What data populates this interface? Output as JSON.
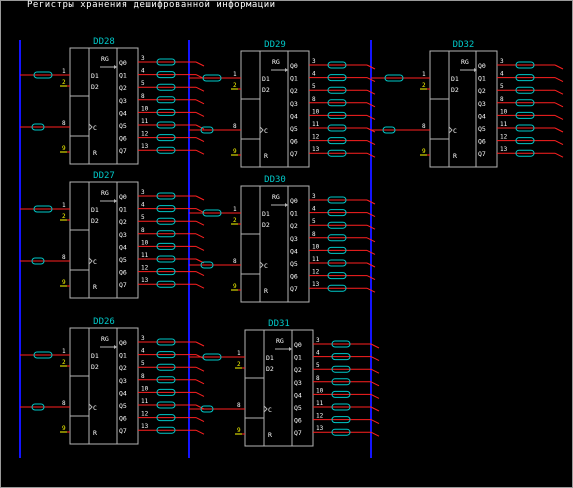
{
  "title": "Регистры хранения дешифрованной информации",
  "bus_color": "#1414ff",
  "wire_color": "#ff2020",
  "chip_color": "#b4b4b4",
  "label_color": "#00c8c8",
  "pin_color": "#ffff00",
  "text_color": "#ffffff",
  "chip_type": "RG",
  "input_labels": {
    "d1": "D1",
    "d2": "D2",
    "c": "C",
    "r": "R"
  },
  "input_pins": {
    "d1": "1",
    "d2": "2",
    "c": "8",
    "r": "9"
  },
  "output_labels": [
    "Q0",
    "Q1",
    "Q2",
    "Q3",
    "Q4",
    "Q5",
    "Q6",
    "Q7"
  ],
  "output_pins": [
    "3",
    "4",
    "5",
    "8",
    "10",
    "11",
    "12",
    "13"
  ],
  "chips": [
    {
      "name": "DD28"
    },
    {
      "name": "DD29"
    },
    {
      "name": "DD32"
    },
    {
      "name": "DD27"
    },
    {
      "name": "DD30"
    },
    {
      "name": "DD26"
    },
    {
      "name": "DD31"
    }
  ]
}
